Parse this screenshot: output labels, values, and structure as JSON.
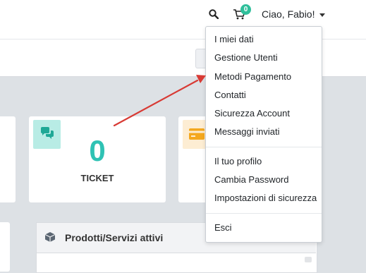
{
  "header": {
    "cart_count": "0",
    "user_greeting": "Ciao, Fabio!"
  },
  "user_dropdown": {
    "group1": [
      "I miei dati",
      "Gestione Utenti",
      "Metodi Pagamento",
      "Contatti",
      "Sicurezza Account",
      "Messaggi inviati"
    ],
    "group2": [
      "Il tuo profilo",
      "Cambia Password",
      "Impostazioni di sicurezza"
    ],
    "group3": [
      "Esci"
    ]
  },
  "dashboard": {
    "ticket_count": "0",
    "ticket_label": "TICKET",
    "services_panel_title": "Prodotti/Servizi attivi"
  },
  "colors": {
    "accent_teal": "#2fc2b4",
    "badge_green": "#2fbf9b",
    "annotation_arrow": "#d83a34"
  },
  "icons": [
    "search-icon",
    "cart-icon",
    "chevron-down-icon",
    "comments-icon",
    "credit-card-icon",
    "box-icon",
    "chevron-up-icon"
  ]
}
